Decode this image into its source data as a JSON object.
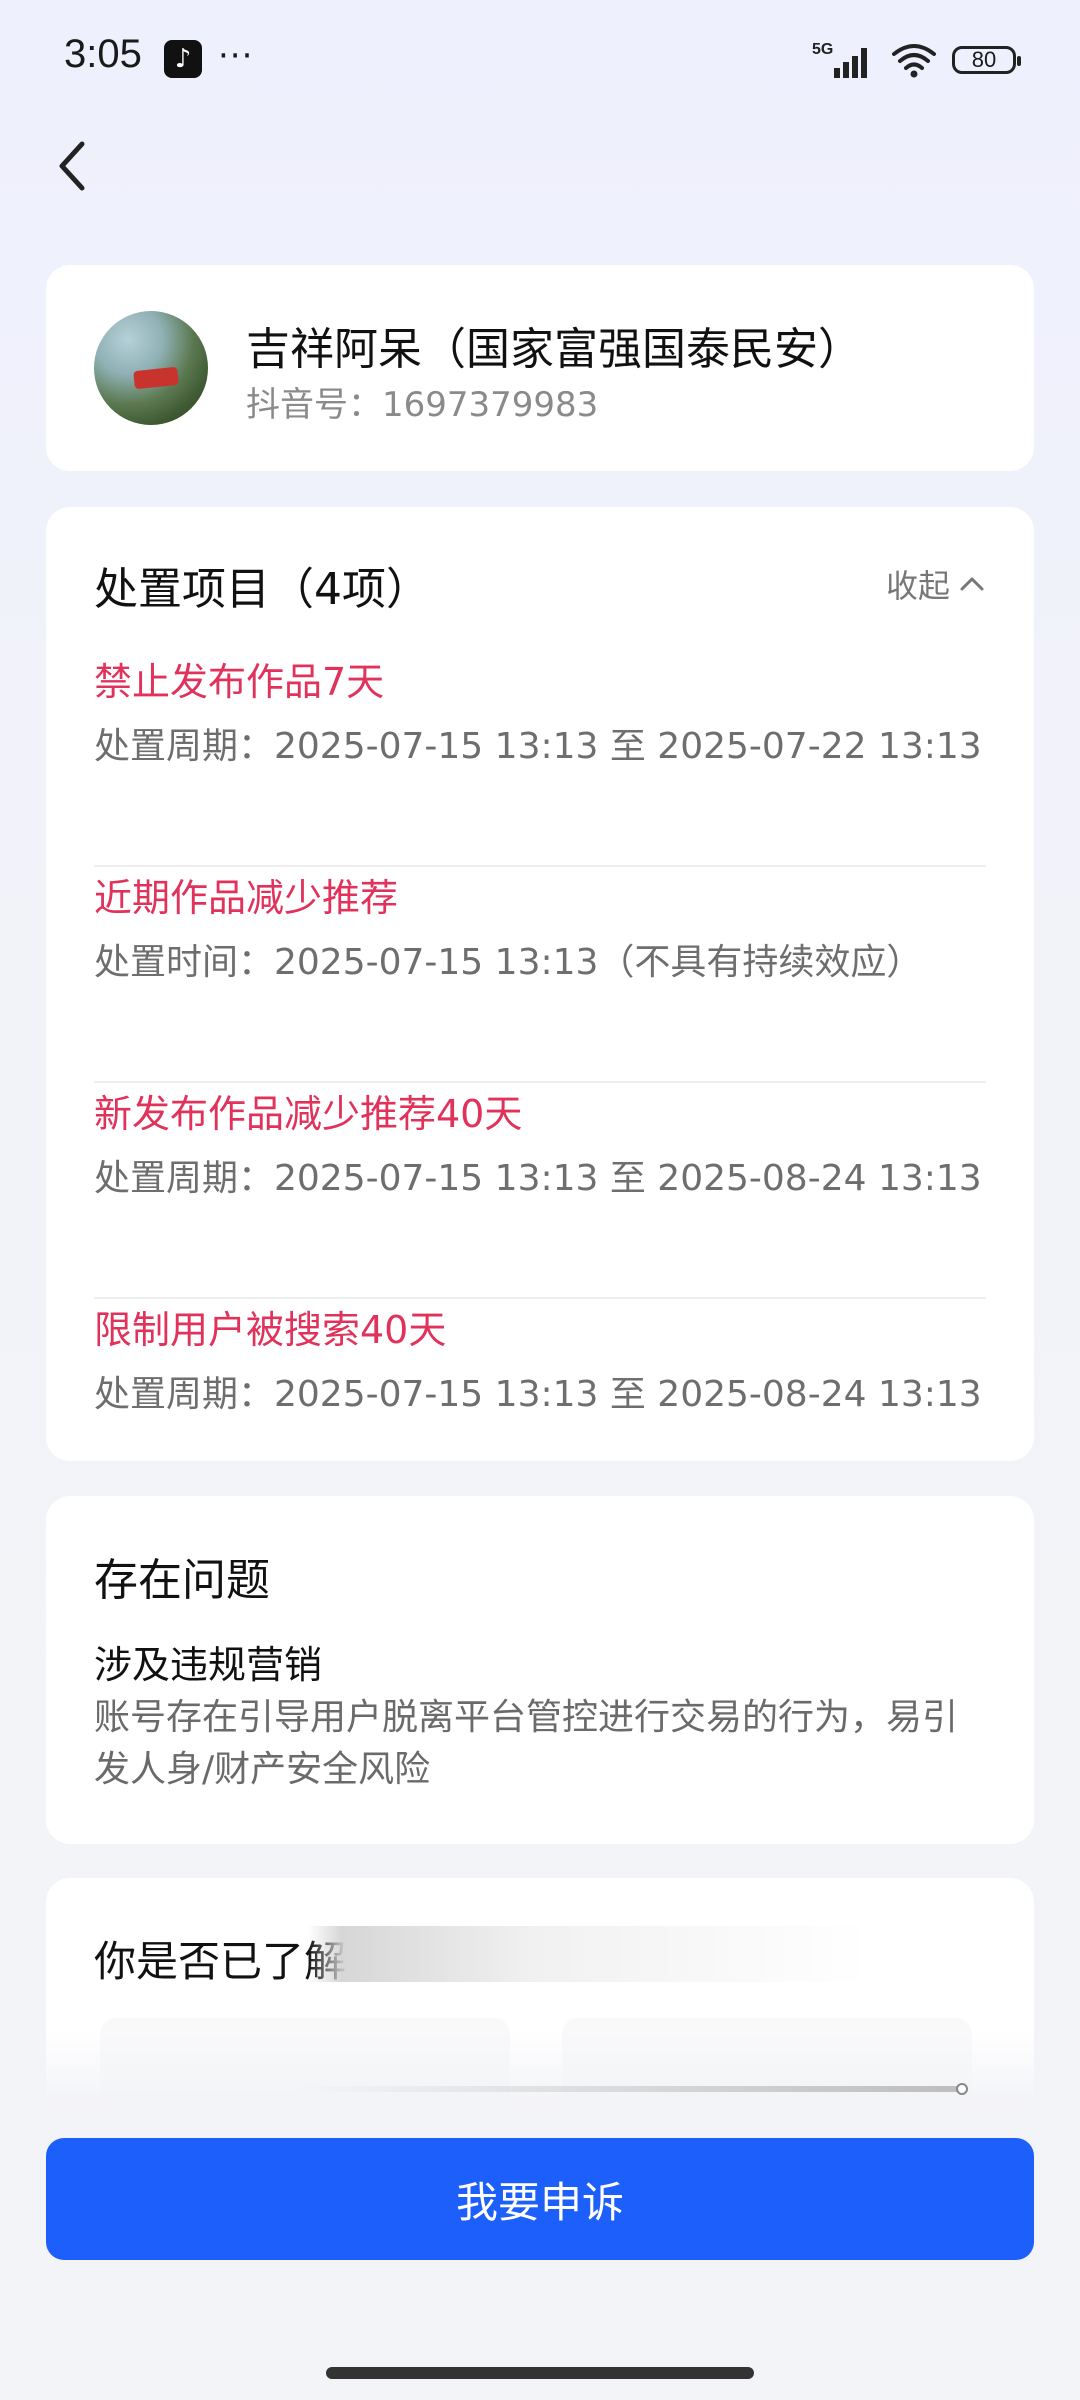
{
  "status_bar": {
    "time": "3:05",
    "app_icon": "tiktok-icon",
    "more": "···",
    "network": "5G",
    "battery": "80"
  },
  "nav": {
    "back_icon": "chevron-left-icon"
  },
  "profile": {
    "name": "吉祥阿呆（国家富强国泰民安）",
    "id_line": "抖音号：1697379983"
  },
  "penalties": {
    "title": "处置项目（4项）",
    "collapse_label": "收起",
    "items": [
      {
        "name": "禁止发布作品7天",
        "period": "处置周期：2025-07-15 13:13 至 2025-07-22 13:13"
      },
      {
        "name": "近期作品减少推荐",
        "period": "处置时间：2025-07-15 13:13（不具有持续效应）"
      },
      {
        "name": "新发布作品减少推荐40天",
        "period": "处置周期：2025-07-15 13:13 至 2025-08-24 13:13"
      },
      {
        "name": "限制用户被搜索40天",
        "period": "处置周期：2025-07-15 13:13 至 2025-08-24 13:13"
      }
    ]
  },
  "problem": {
    "title": "存在问题",
    "heading": "涉及违规营销",
    "description": "账号存在引导用户脱离平台管控进行交易的行为，易引发人身/财产安全风险"
  },
  "question": {
    "title": "你是否已了解"
  },
  "appeal_button": "我要申诉",
  "colors": {
    "accent_blue": "#1d5ffb",
    "penalty_red": "#e0325a"
  }
}
